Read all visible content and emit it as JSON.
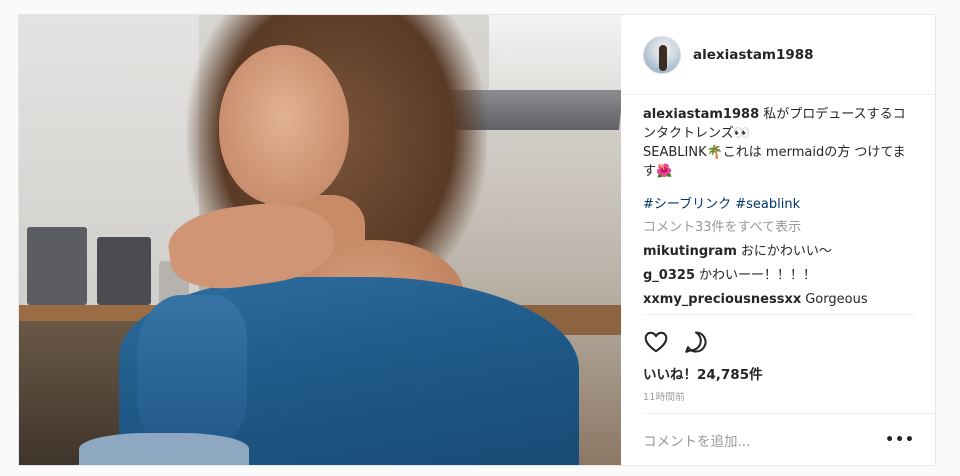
{
  "header": {
    "username": "alexiastam1988"
  },
  "caption": {
    "user": "alexiastam1988",
    "text": "私がプロデュースするコンタクトレンズ👀\nSEABLINK🌴これは mermaidの方 つけてます🌺",
    "hashtags": "#シーブリンク #seablink"
  },
  "comments": {
    "view_all": "コメント33件をすべて表示",
    "items": [
      {
        "user": "mikutingram",
        "text": "おにかわいい〜"
      },
      {
        "user": "g_0325",
        "text": "かわいーー！！！！"
      },
      {
        "user": "xxmy_preciousnessxx",
        "text": "Gorgeous"
      }
    ],
    "partial": "...... ...... ......"
  },
  "actions": {
    "like_icon": "heart-icon",
    "comment_icon": "speech-bubble-icon"
  },
  "likes": "いいね！24,785件",
  "time": "11時間前",
  "add_comment": {
    "placeholder": "コメントを追加...",
    "more_label": "•••"
  }
}
